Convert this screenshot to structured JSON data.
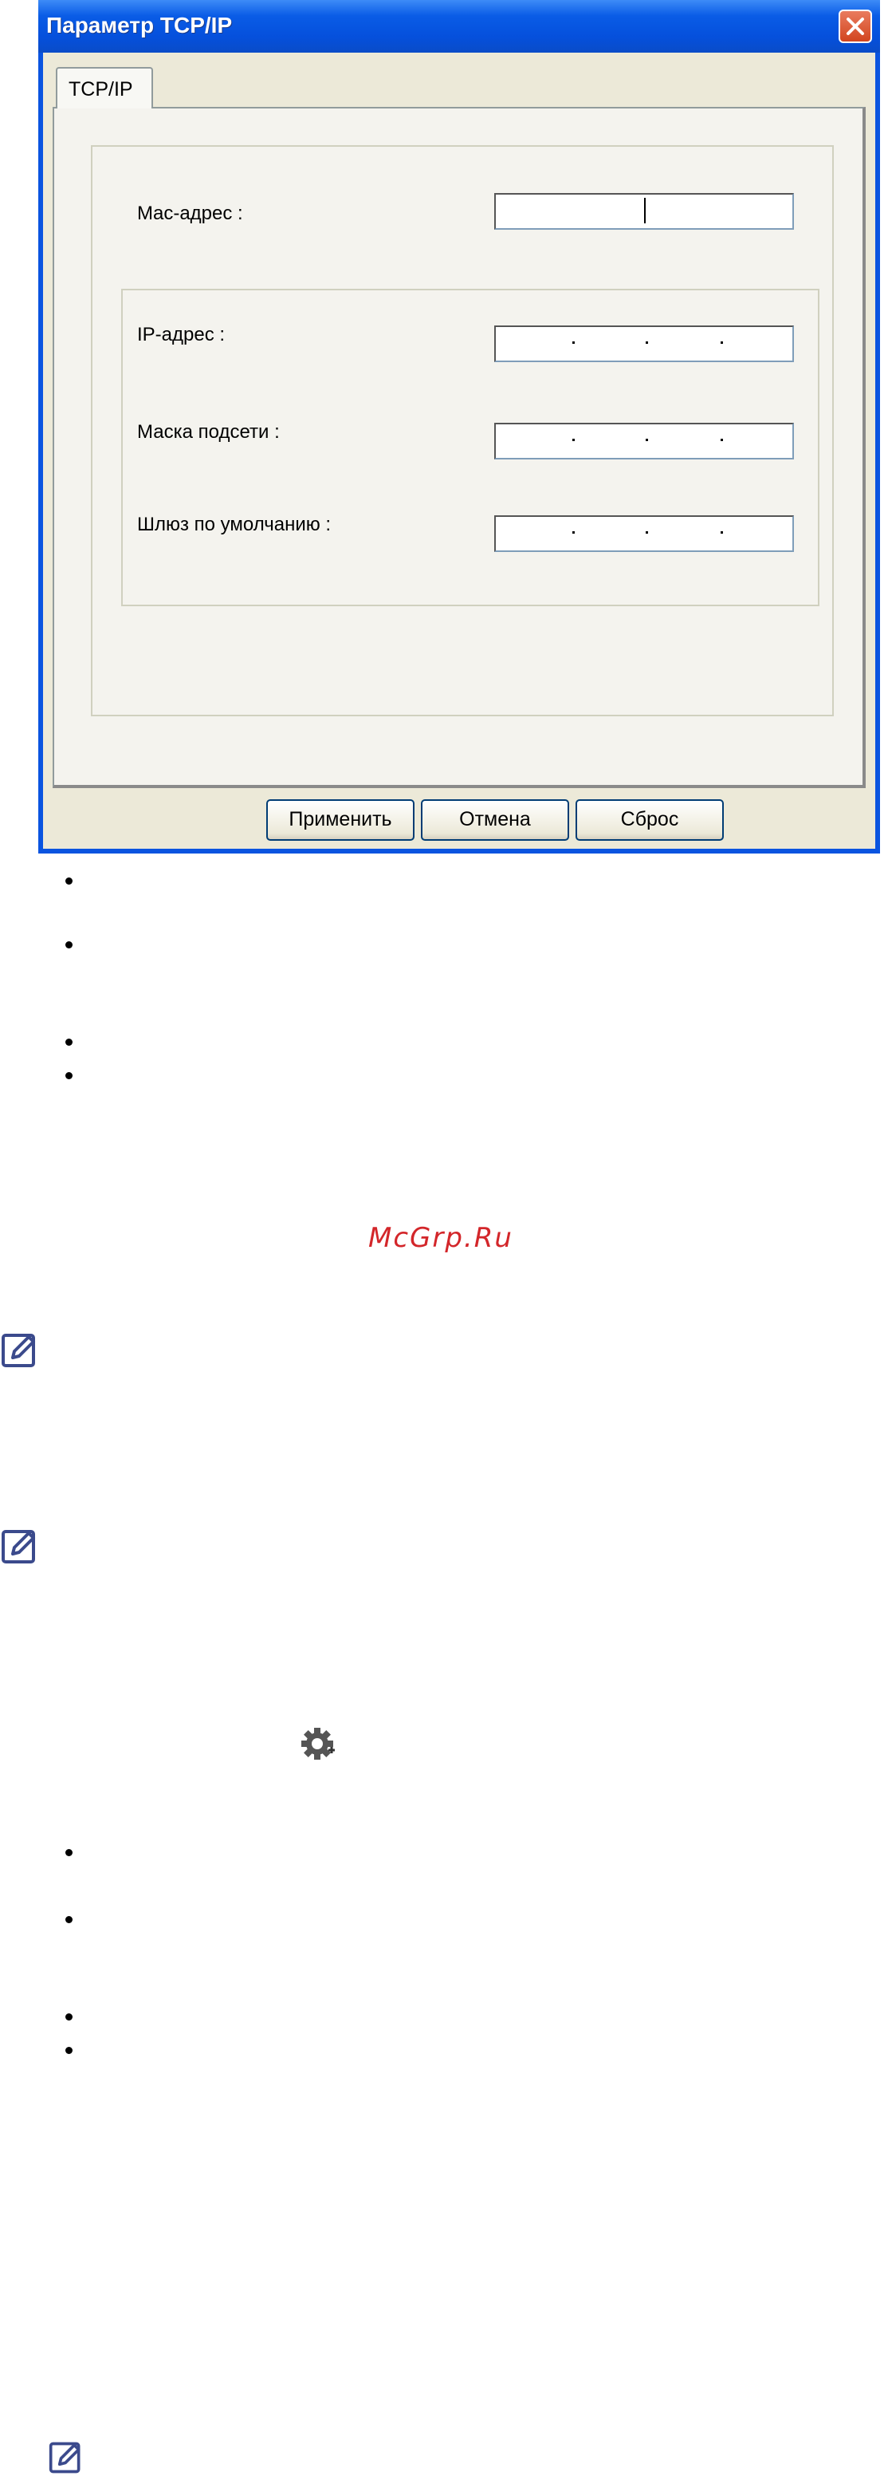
{
  "dialog": {
    "title": "Параметр TCP/IP",
    "tab_label": "TCP/IP",
    "fields": {
      "mac_label": "Mac-адрес :",
      "ip_label": "IP-адрес :",
      "mask_label": "Маска подсети :",
      "gateway_label": "Шлюз по умолчанию :"
    },
    "buttons": {
      "apply": "Применить",
      "cancel": "Отмена",
      "reset": "Сброс"
    }
  },
  "watermark": "McGrp.Ru",
  "icons": {
    "close": "close-icon",
    "note": "note-icon",
    "gear": "gear-icon",
    "bullet": "bullet-icon"
  },
  "colors": {
    "titlebar": "#0a54e0",
    "client_bg": "#ece9d8",
    "close_button": "#d2451f",
    "watermark": "#d3262a",
    "note_icon": "#3b4a8c"
  }
}
